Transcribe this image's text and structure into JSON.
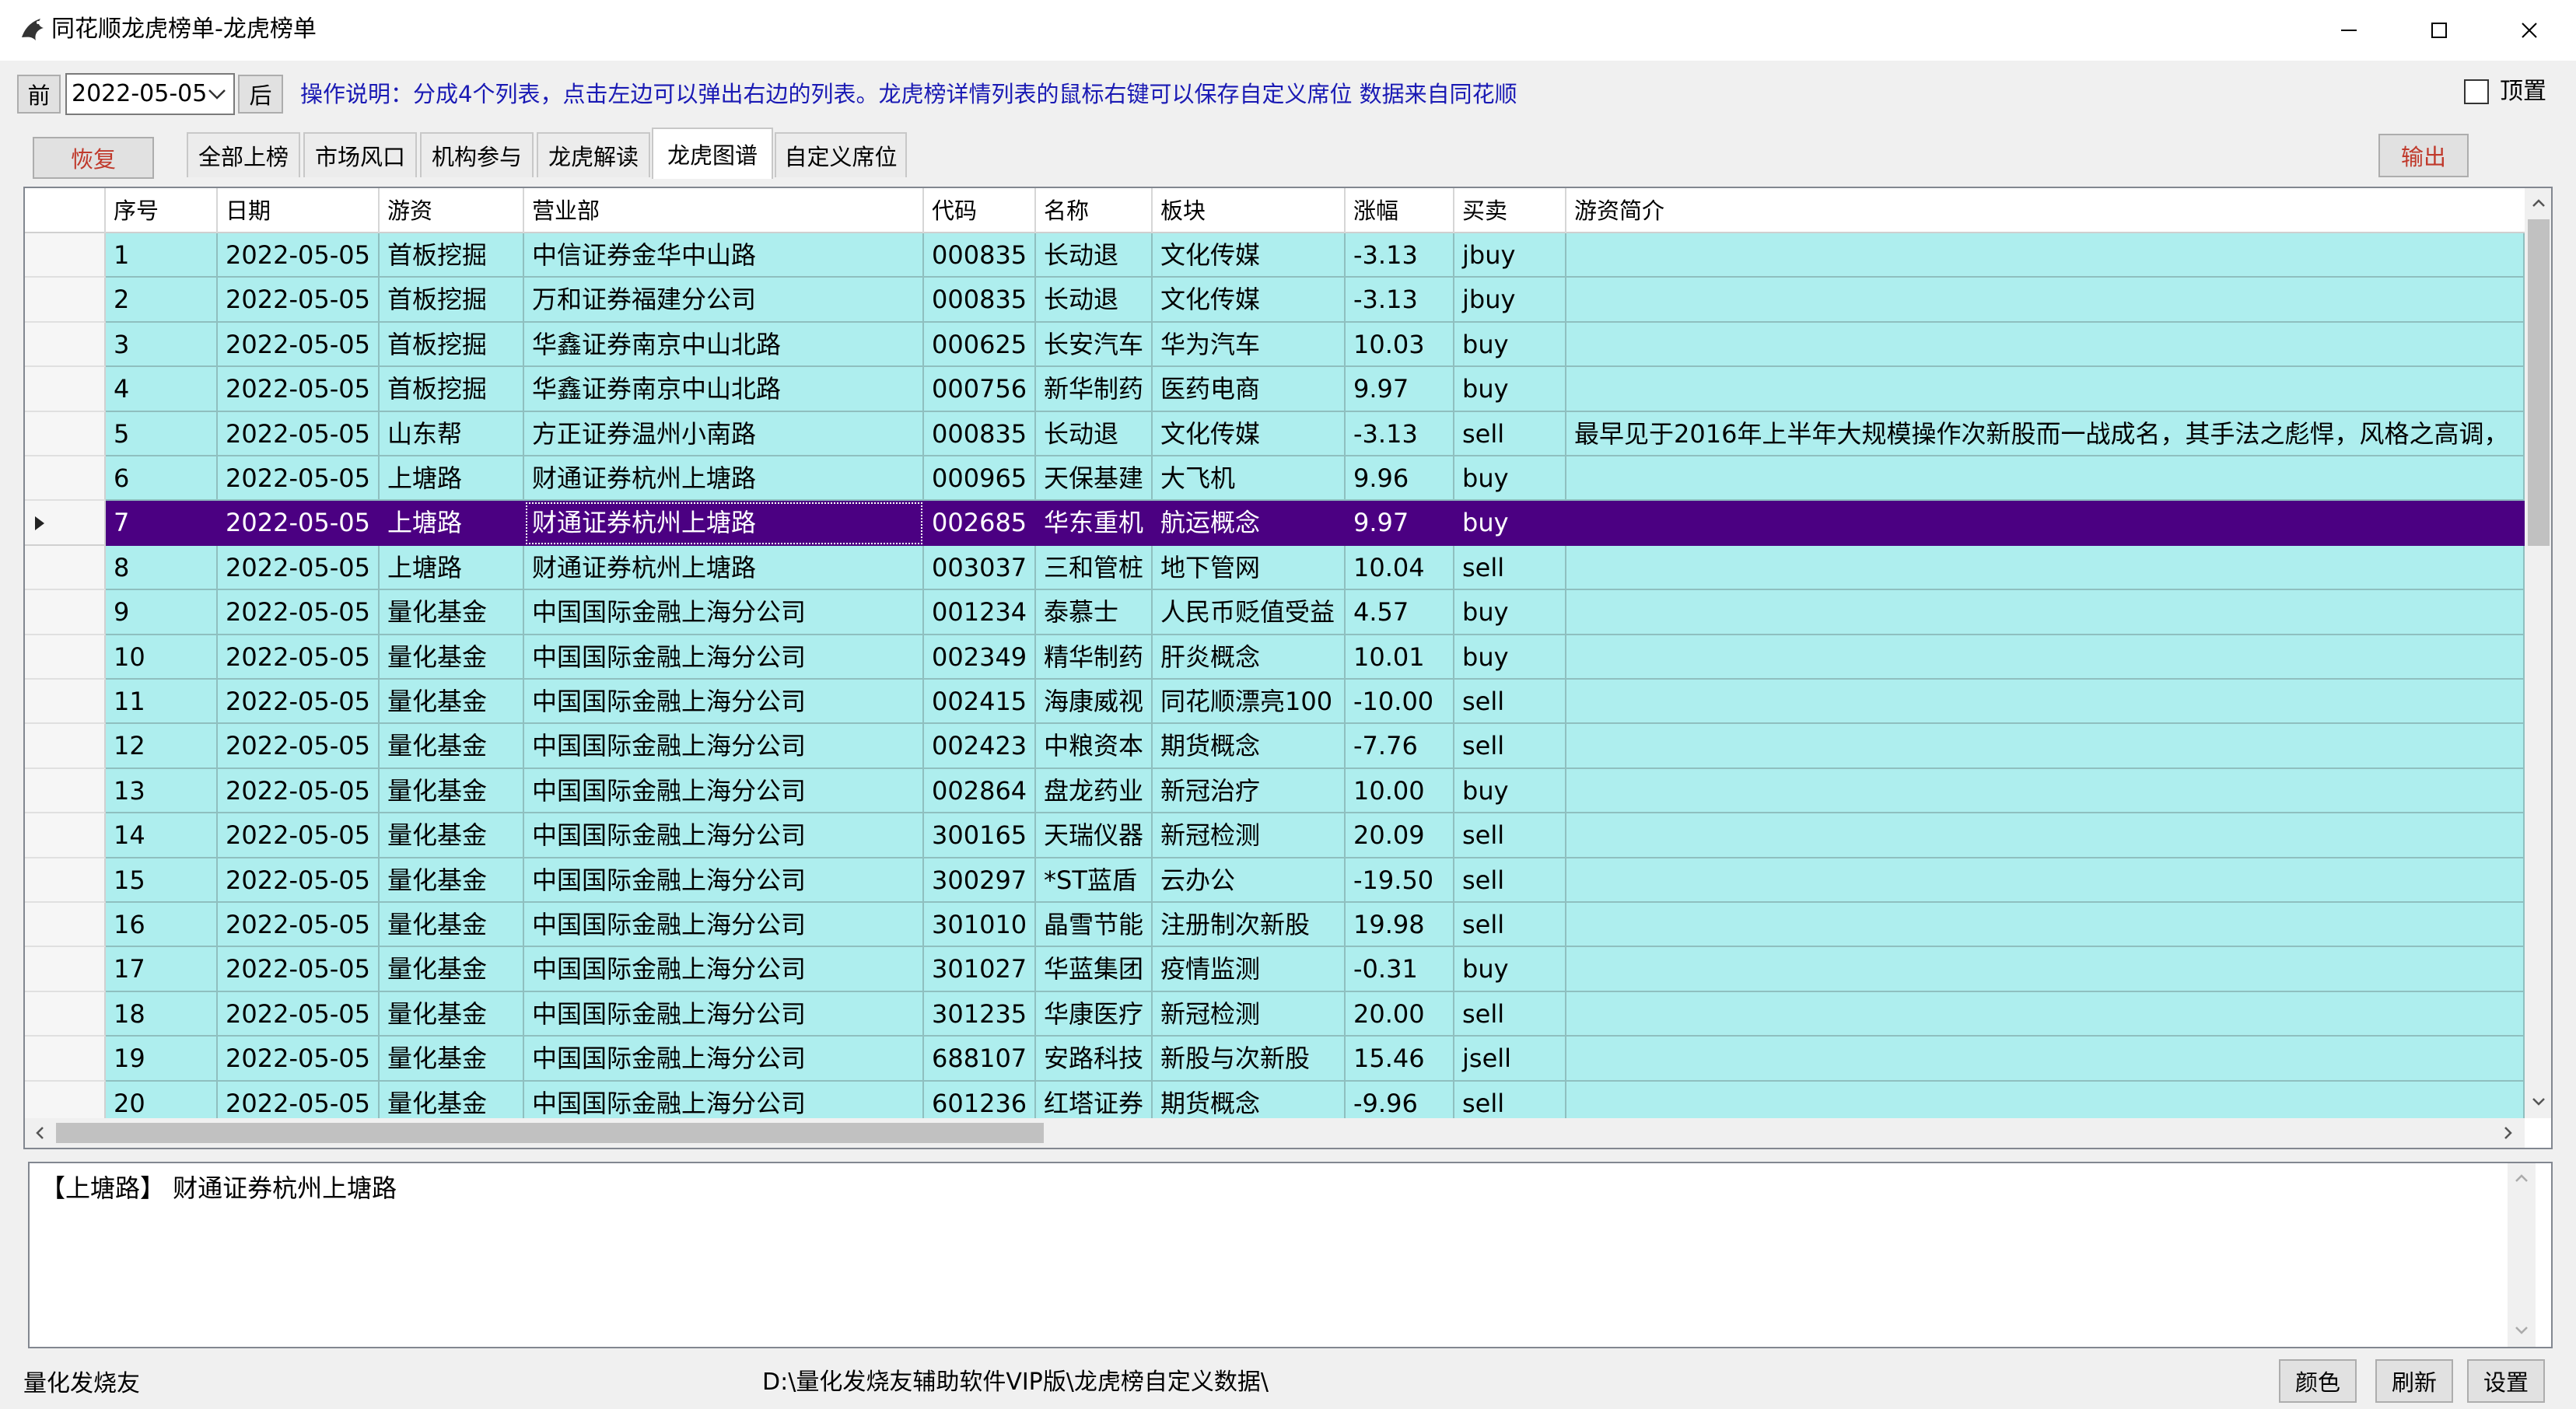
{
  "window": {
    "title": "同花顺龙虎榜单-龙虎榜单"
  },
  "toolbar": {
    "prev_label": "前",
    "date_value": "2022-05-05",
    "next_label": "后",
    "instructions": "操作说明：分成4个列表，点击左边可以弹出右边的列表。龙虎榜详情列表的鼠标右键可以保存自定义席位 数据来自同花顺",
    "pin_label": "顶置",
    "restore_label": "恢复",
    "export_label": "输出"
  },
  "tabs": [
    {
      "label": "全部上榜",
      "active": false
    },
    {
      "label": "市场风口",
      "active": false
    },
    {
      "label": "机构参与",
      "active": false
    },
    {
      "label": "龙虎解读",
      "active": false
    },
    {
      "label": "龙虎图谱",
      "active": true
    },
    {
      "label": "自定义席位",
      "active": false
    }
  ],
  "grid": {
    "columns": [
      "序号",
      "日期",
      "游资",
      "营业部",
      "代码",
      "名称",
      "板块",
      "涨幅",
      "买卖",
      "游资简介"
    ],
    "selected_row": 7,
    "rows": [
      [
        "1",
        "2022-05-05",
        "首板挖掘",
        "中信证券金华中山路",
        "000835",
        "长动退",
        "文化传媒",
        "-3.13",
        "jbuy",
        ""
      ],
      [
        "2",
        "2022-05-05",
        "首板挖掘",
        "万和证券福建分公司",
        "000835",
        "长动退",
        "文化传媒",
        "-3.13",
        "jbuy",
        ""
      ],
      [
        "3",
        "2022-05-05",
        "首板挖掘",
        "华鑫证券南京中山北路",
        "000625",
        "长安汽车",
        "华为汽车",
        "10.03",
        "buy",
        ""
      ],
      [
        "4",
        "2022-05-05",
        "首板挖掘",
        "华鑫证券南京中山北路",
        "000756",
        "新华制药",
        "医药电商",
        "9.97",
        "buy",
        ""
      ],
      [
        "5",
        "2022-05-05",
        "山东帮",
        "方正证券温州小南路",
        "000835",
        "长动退",
        "文化传媒",
        "-3.13",
        "sell",
        "最早见于2016年上半年大规模操作次新股而一战成名，其手法之彪悍，风格之高调，"
      ],
      [
        "6",
        "2022-05-05",
        "上塘路",
        "财通证券杭州上塘路",
        "000965",
        "天保基建",
        "大飞机",
        "9.96",
        "buy",
        ""
      ],
      [
        "7",
        "2022-05-05",
        "上塘路",
        "财通证券杭州上塘路",
        "002685",
        "华东重机",
        "航运概念",
        "9.97",
        "buy",
        ""
      ],
      [
        "8",
        "2022-05-05",
        "上塘路",
        "财通证券杭州上塘路",
        "003037",
        "三和管桩",
        "地下管网",
        "10.04",
        "sell",
        ""
      ],
      [
        "9",
        "2022-05-05",
        "量化基金",
        "中国国际金融上海分公司",
        "001234",
        "泰慕士",
        "人民币贬值受益",
        "4.57",
        "buy",
        ""
      ],
      [
        "10",
        "2022-05-05",
        "量化基金",
        "中国国际金融上海分公司",
        "002349",
        "精华制药",
        "肝炎概念",
        "10.01",
        "buy",
        ""
      ],
      [
        "11",
        "2022-05-05",
        "量化基金",
        "中国国际金融上海分公司",
        "002415",
        "海康威视",
        "同花顺漂亮100",
        "-10.00",
        "sell",
        ""
      ],
      [
        "12",
        "2022-05-05",
        "量化基金",
        "中国国际金融上海分公司",
        "002423",
        "中粮资本",
        "期货概念",
        "-7.76",
        "sell",
        ""
      ],
      [
        "13",
        "2022-05-05",
        "量化基金",
        "中国国际金融上海分公司",
        "002864",
        "盘龙药业",
        "新冠治疗",
        "10.00",
        "buy",
        ""
      ],
      [
        "14",
        "2022-05-05",
        "量化基金",
        "中国国际金融上海分公司",
        "300165",
        "天瑞仪器",
        "新冠检测",
        "20.09",
        "sell",
        ""
      ],
      [
        "15",
        "2022-05-05",
        "量化基金",
        "中国国际金融上海分公司",
        "300297",
        "*ST蓝盾",
        "云办公",
        "-19.50",
        "sell",
        ""
      ],
      [
        "16",
        "2022-05-05",
        "量化基金",
        "中国国际金融上海分公司",
        "301010",
        "晶雪节能",
        "注册制次新股",
        "19.98",
        "sell",
        ""
      ],
      [
        "17",
        "2022-05-05",
        "量化基金",
        "中国国际金融上海分公司",
        "301027",
        "华蓝集团",
        "疫情监测",
        "-0.31",
        "buy",
        ""
      ],
      [
        "18",
        "2022-05-05",
        "量化基金",
        "中国国际金融上海分公司",
        "301235",
        "华康医疗",
        "新冠检测",
        "20.00",
        "sell",
        ""
      ],
      [
        "19",
        "2022-05-05",
        "量化基金",
        "中国国际金融上海分公司",
        "688107",
        "安路科技",
        "新股与次新股",
        "15.46",
        "jsell",
        ""
      ],
      [
        "20",
        "2022-05-05",
        "量化基金",
        "中国国际金融上海分公司",
        "601236",
        "红塔证券",
        "期货概念",
        "-9.96",
        "sell",
        ""
      ]
    ]
  },
  "detail": {
    "text": "【上塘路】   财通证券杭州上塘路"
  },
  "statusbar": {
    "left_text": "量化发烧友",
    "path": "D:\\量化发烧友辅助软件VIP版\\龙虎榜自定义数据\\",
    "color_label": "颜色",
    "refresh_label": "刷新",
    "settings_label": "设置"
  },
  "colors": {
    "row_bg": "#aeeeee",
    "selected_bg": "#4b0082",
    "instructions_text": "#1a1ab4",
    "button_accent_text": "#c0392b"
  }
}
